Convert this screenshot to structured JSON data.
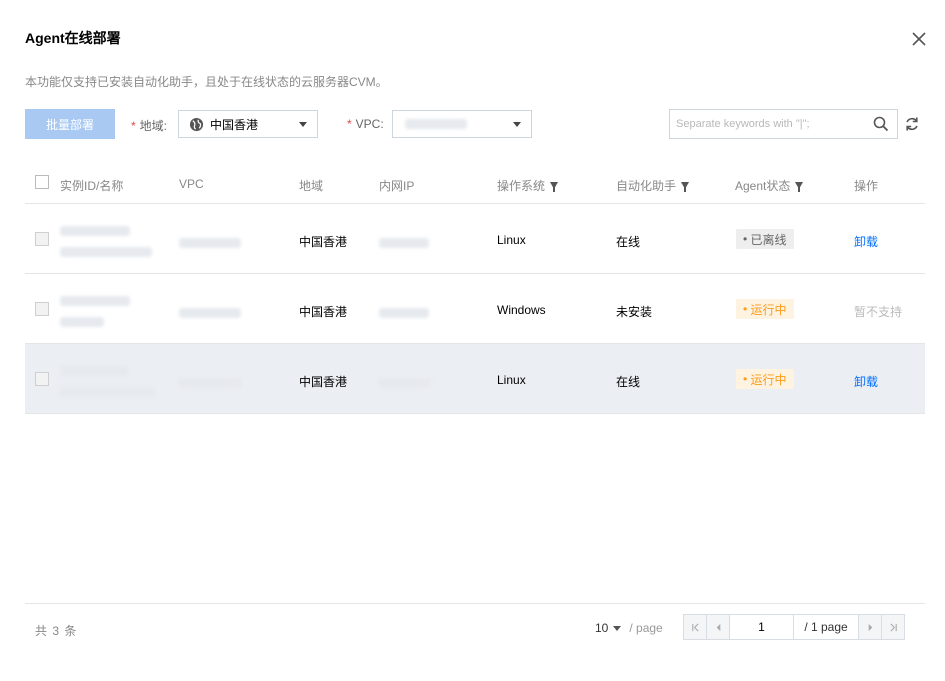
{
  "dialog": {
    "title": "Agent在线部署",
    "description": "本功能仅支持已安装自动化助手，且处于在线状态的云服务器CVM。"
  },
  "toolbar": {
    "deploy_label": "批量部署",
    "region_label": "地域:",
    "region_value": "中国香港",
    "vpc_label": "VPC:",
    "search_placeholder": "Separate keywords with \"|\";",
    "required_mark": "*"
  },
  "table": {
    "columns": [
      "实例ID/名称",
      "VPC",
      "地域",
      "内网IP",
      "操作系统",
      "自动化助手",
      "Agent状态",
      "操作"
    ],
    "rows": [
      {
        "region": "中国香港",
        "os": "Linux",
        "assistant": "在线",
        "status": "已离线",
        "action": "卸载"
      },
      {
        "region": "中国香港",
        "os": "Windows",
        "assistant": "未安装",
        "status": "运行中",
        "action": "暂不支持"
      },
      {
        "region": "中国香港",
        "os": "Linux",
        "assistant": "在线",
        "status": "运行中",
        "action": "卸载"
      }
    ]
  },
  "footer": {
    "total": "共 3 条",
    "page_size": "10",
    "page_unit": "/ page",
    "current_page": "1",
    "total_pages": "/ 1 page"
  },
  "colors": {
    "primary_disabled": "#A9C9F3",
    "link": "#006EFF",
    "running": "#FF9C19",
    "highlight_row": "#EBEEF3"
  },
  "icons": [
    "close-icon",
    "globe-icon",
    "search-icon",
    "refresh-icon",
    "filter-icon",
    "first-page-icon",
    "prev-page-icon",
    "next-page-icon",
    "last-page-icon"
  ]
}
